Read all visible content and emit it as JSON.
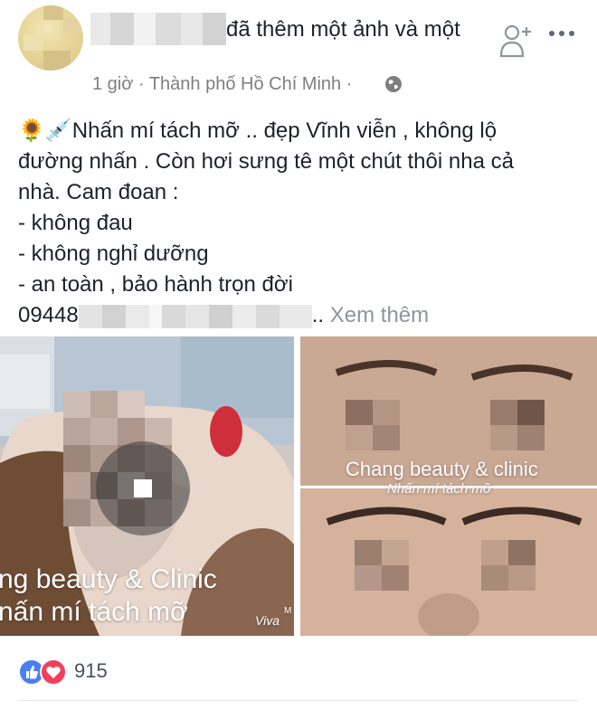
{
  "header": {
    "action_text": "đã thêm một ảnh và một",
    "time": "1 giờ",
    "location": "Thành phố Hồ Chí Minh",
    "separator": "·"
  },
  "icons": {
    "add_friend": "add-friend-icon",
    "more": "more-icon",
    "privacy": "globe-icon",
    "sunflower": "🌻",
    "syringe": "💉",
    "like": "like-icon",
    "love": "love-icon"
  },
  "post": {
    "line1": "Nhấn mí tách mỡ .. đẹp Vĩnh viễn , không lộ",
    "line2": "đường nhấn . Còn hơi sưng tê một chút thôi nha cả",
    "line3": "nhà. Cam đoan :",
    "line4": "- không đau",
    "line5": "- không nghỉ dưỡng",
    "line6": "- an toàn , bảo hành trọn đời",
    "phone_prefix": "09448",
    "ellipsis": "..",
    "see_more": "Xem thêm"
  },
  "photos": {
    "left_caption_1": "ng beauty & Clinic",
    "left_caption_2": "nấn mí tách mỡ",
    "left_watermark": "Viva",
    "left_watermark_small": "M",
    "right_caption_1": "Chang beauty & clinic",
    "right_caption_2": "Nhấn mí tách mỡ"
  },
  "reactions": {
    "count": "915"
  },
  "colors": {
    "meta_gray": "#90949c",
    "like_blue": "#4a7ef2",
    "love_red": "#f0405d",
    "text": "#1d2129"
  }
}
